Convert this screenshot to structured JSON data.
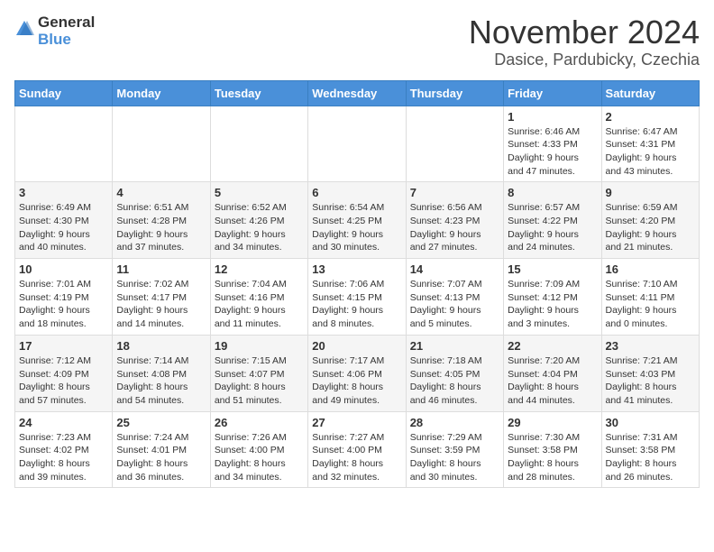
{
  "header": {
    "logo_general": "General",
    "logo_blue": "Blue",
    "month_title": "November 2024",
    "location": "Dasice, Pardubicky, Czechia"
  },
  "weekdays": [
    "Sunday",
    "Monday",
    "Tuesday",
    "Wednesday",
    "Thursday",
    "Friday",
    "Saturday"
  ],
  "weeks": [
    [
      {
        "day": "",
        "info": ""
      },
      {
        "day": "",
        "info": ""
      },
      {
        "day": "",
        "info": ""
      },
      {
        "day": "",
        "info": ""
      },
      {
        "day": "",
        "info": ""
      },
      {
        "day": "1",
        "info": "Sunrise: 6:46 AM\nSunset: 4:33 PM\nDaylight: 9 hours\nand 47 minutes."
      },
      {
        "day": "2",
        "info": "Sunrise: 6:47 AM\nSunset: 4:31 PM\nDaylight: 9 hours\nand 43 minutes."
      }
    ],
    [
      {
        "day": "3",
        "info": "Sunrise: 6:49 AM\nSunset: 4:30 PM\nDaylight: 9 hours\nand 40 minutes."
      },
      {
        "day": "4",
        "info": "Sunrise: 6:51 AM\nSunset: 4:28 PM\nDaylight: 9 hours\nand 37 minutes."
      },
      {
        "day": "5",
        "info": "Sunrise: 6:52 AM\nSunset: 4:26 PM\nDaylight: 9 hours\nand 34 minutes."
      },
      {
        "day": "6",
        "info": "Sunrise: 6:54 AM\nSunset: 4:25 PM\nDaylight: 9 hours\nand 30 minutes."
      },
      {
        "day": "7",
        "info": "Sunrise: 6:56 AM\nSunset: 4:23 PM\nDaylight: 9 hours\nand 27 minutes."
      },
      {
        "day": "8",
        "info": "Sunrise: 6:57 AM\nSunset: 4:22 PM\nDaylight: 9 hours\nand 24 minutes."
      },
      {
        "day": "9",
        "info": "Sunrise: 6:59 AM\nSunset: 4:20 PM\nDaylight: 9 hours\nand 21 minutes."
      }
    ],
    [
      {
        "day": "10",
        "info": "Sunrise: 7:01 AM\nSunset: 4:19 PM\nDaylight: 9 hours\nand 18 minutes."
      },
      {
        "day": "11",
        "info": "Sunrise: 7:02 AM\nSunset: 4:17 PM\nDaylight: 9 hours\nand 14 minutes."
      },
      {
        "day": "12",
        "info": "Sunrise: 7:04 AM\nSunset: 4:16 PM\nDaylight: 9 hours\nand 11 minutes."
      },
      {
        "day": "13",
        "info": "Sunrise: 7:06 AM\nSunset: 4:15 PM\nDaylight: 9 hours\nand 8 minutes."
      },
      {
        "day": "14",
        "info": "Sunrise: 7:07 AM\nSunset: 4:13 PM\nDaylight: 9 hours\nand 5 minutes."
      },
      {
        "day": "15",
        "info": "Sunrise: 7:09 AM\nSunset: 4:12 PM\nDaylight: 9 hours\nand 3 minutes."
      },
      {
        "day": "16",
        "info": "Sunrise: 7:10 AM\nSunset: 4:11 PM\nDaylight: 9 hours\nand 0 minutes."
      }
    ],
    [
      {
        "day": "17",
        "info": "Sunrise: 7:12 AM\nSunset: 4:09 PM\nDaylight: 8 hours\nand 57 minutes."
      },
      {
        "day": "18",
        "info": "Sunrise: 7:14 AM\nSunset: 4:08 PM\nDaylight: 8 hours\nand 54 minutes."
      },
      {
        "day": "19",
        "info": "Sunrise: 7:15 AM\nSunset: 4:07 PM\nDaylight: 8 hours\nand 51 minutes."
      },
      {
        "day": "20",
        "info": "Sunrise: 7:17 AM\nSunset: 4:06 PM\nDaylight: 8 hours\nand 49 minutes."
      },
      {
        "day": "21",
        "info": "Sunrise: 7:18 AM\nSunset: 4:05 PM\nDaylight: 8 hours\nand 46 minutes."
      },
      {
        "day": "22",
        "info": "Sunrise: 7:20 AM\nSunset: 4:04 PM\nDaylight: 8 hours\nand 44 minutes."
      },
      {
        "day": "23",
        "info": "Sunrise: 7:21 AM\nSunset: 4:03 PM\nDaylight: 8 hours\nand 41 minutes."
      }
    ],
    [
      {
        "day": "24",
        "info": "Sunrise: 7:23 AM\nSunset: 4:02 PM\nDaylight: 8 hours\nand 39 minutes."
      },
      {
        "day": "25",
        "info": "Sunrise: 7:24 AM\nSunset: 4:01 PM\nDaylight: 8 hours\nand 36 minutes."
      },
      {
        "day": "26",
        "info": "Sunrise: 7:26 AM\nSunset: 4:00 PM\nDaylight: 8 hours\nand 34 minutes."
      },
      {
        "day": "27",
        "info": "Sunrise: 7:27 AM\nSunset: 4:00 PM\nDaylight: 8 hours\nand 32 minutes."
      },
      {
        "day": "28",
        "info": "Sunrise: 7:29 AM\nSunset: 3:59 PM\nDaylight: 8 hours\nand 30 minutes."
      },
      {
        "day": "29",
        "info": "Sunrise: 7:30 AM\nSunset: 3:58 PM\nDaylight: 8 hours\nand 28 minutes."
      },
      {
        "day": "30",
        "info": "Sunrise: 7:31 AM\nSunset: 3:58 PM\nDaylight: 8 hours\nand 26 minutes."
      }
    ]
  ]
}
